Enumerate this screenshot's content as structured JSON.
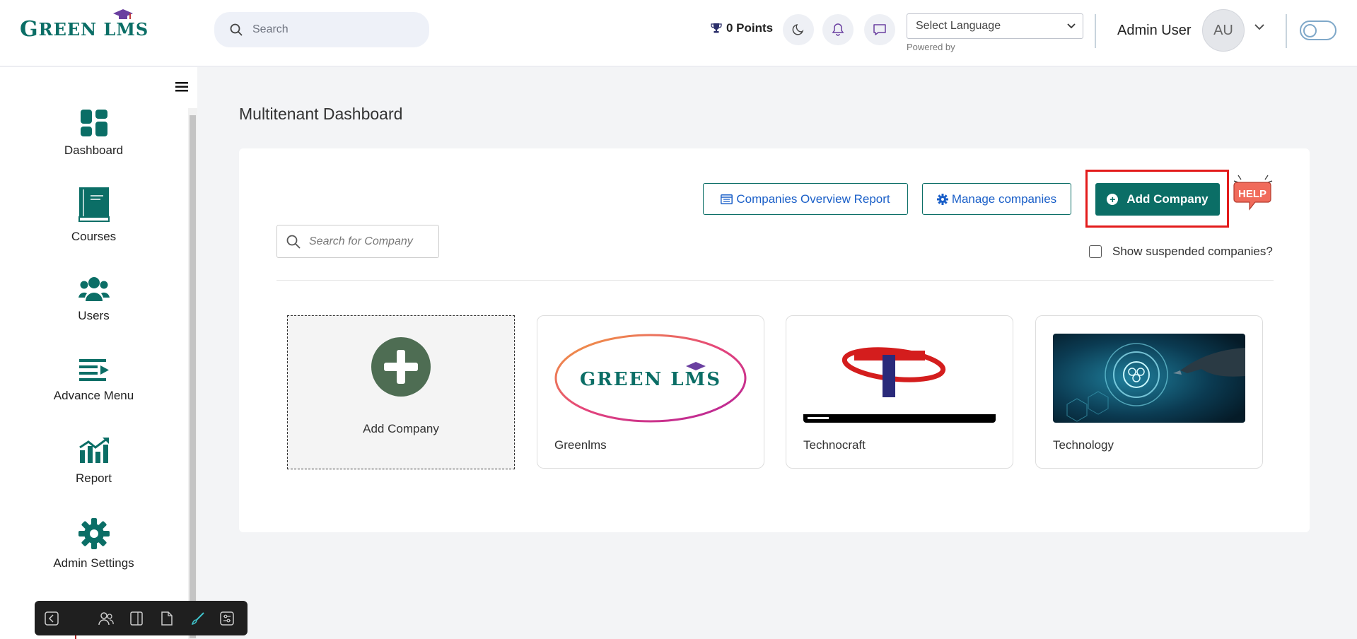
{
  "header": {
    "logo_text": "GREEN LMS",
    "search_placeholder": "Search",
    "points": "0 Points",
    "language_select": "Select Language",
    "powered_by": "Powered by",
    "user_name": "Admin User",
    "avatar_initials": "AU"
  },
  "sidebar": {
    "items": [
      {
        "label": "Dashboard",
        "icon": "dashboard-icon"
      },
      {
        "label": "Courses",
        "icon": "book-icon"
      },
      {
        "label": "Users",
        "icon": "users-icon"
      },
      {
        "label": "Advance Menu",
        "icon": "advance-menu-icon"
      },
      {
        "label": "Report",
        "icon": "report-chart-icon"
      },
      {
        "label": "Admin Settings",
        "icon": "gear-icon"
      }
    ]
  },
  "main": {
    "title": "Multitenant Dashboard",
    "buttons": {
      "overview_report": "Companies Overview Report",
      "manage_companies": "Manage companies",
      "add_company": "Add Company"
    },
    "help_label": "HELP",
    "company_search_placeholder": "Search for Company",
    "show_suspended_label": "Show suspended companies?",
    "add_card_label": "Add Company",
    "companies": [
      {
        "name": "Greenlms"
      },
      {
        "name": "Technocraft"
      },
      {
        "name": "Technology"
      }
    ]
  },
  "colors": {
    "brand": "#0b6e66",
    "link": "#1a5fc8",
    "highlight": "#e31b1b"
  }
}
